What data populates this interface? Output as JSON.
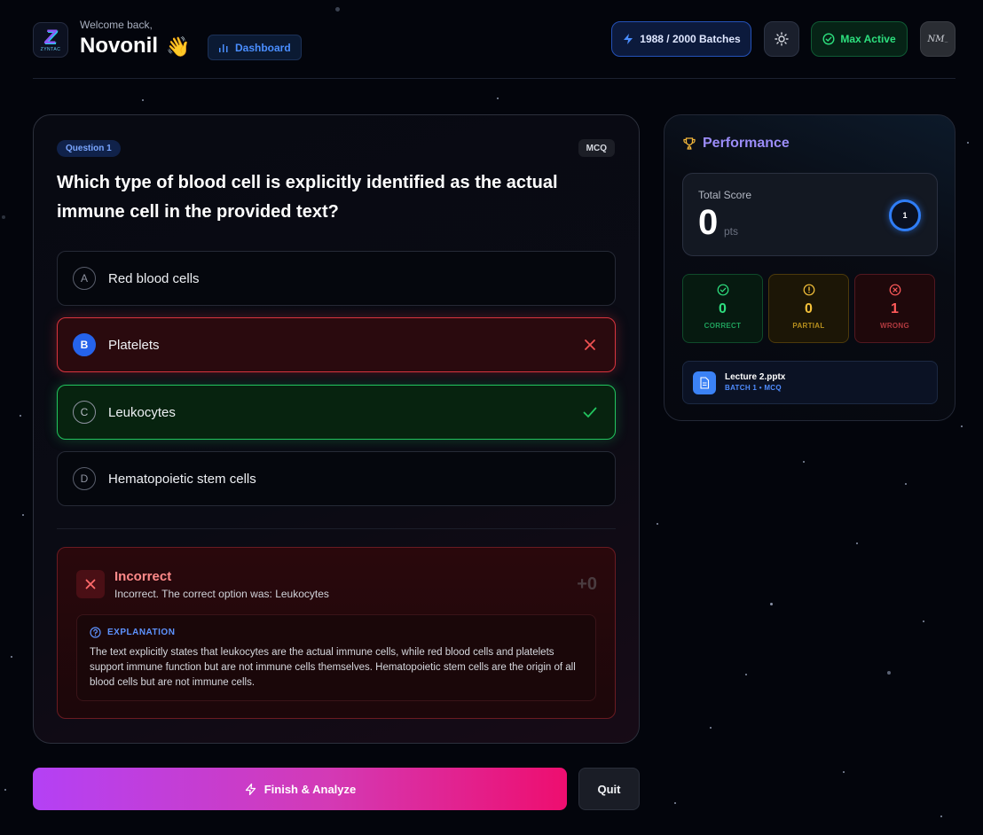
{
  "header": {
    "logo_text": "ZYNTAC",
    "welcome": "Welcome back,",
    "username": "Novonil",
    "wave": "👋",
    "dashboard_label": "Dashboard",
    "batches_label": "1988 / 2000 Batches",
    "max_active_label": "Max Active",
    "avatar_text": "NM"
  },
  "question": {
    "badge": "Question 1",
    "type": "MCQ",
    "text": "Which type of blood cell is explicitly identified as the actual immune cell in the provided text?",
    "options": [
      {
        "letter": "A",
        "text": "Red blood cells",
        "state": "neutral"
      },
      {
        "letter": "B",
        "text": "Platelets",
        "state": "wrong"
      },
      {
        "letter": "C",
        "text": "Leukocytes",
        "state": "correct"
      },
      {
        "letter": "D",
        "text": "Hematopoietic stem cells",
        "state": "neutral"
      }
    ]
  },
  "feedback": {
    "title": "Incorrect",
    "subtitle": "Incorrect. The correct option was: Leukocytes",
    "points": "+0",
    "explanation_label": "EXPLANATION",
    "explanation": "The text explicitly states that leukocytes are the actual immune cells, while red blood cells and platelets support immune function but are not immune cells themselves. Hematopoietic stem cells are the origin of all blood cells but are not immune cells."
  },
  "actions": {
    "finish_label": "Finish & Analyze",
    "quit_label": "Quit"
  },
  "performance": {
    "title": "Performance",
    "score_label": "Total Score",
    "score_value": "0",
    "score_unit": "pts",
    "ring_value": "1",
    "correct": {
      "value": "0",
      "label": "CORRECT"
    },
    "partial": {
      "value": "0",
      "label": "PARTIAL"
    },
    "wrong": {
      "value": "1",
      "label": "WRONG"
    },
    "file_name": "Lecture 2.pptx",
    "file_meta": "BATCH 1 • MCQ"
  },
  "colors": {
    "accent_blue": "#2563eb",
    "correct_green": "#22c55e",
    "wrong_red": "#d8343e",
    "partial_yellow": "#f6c23a",
    "finish_gradient_start": "#b441f5",
    "finish_gradient_end": "#ee0e6f"
  },
  "icons": {
    "dashboard": "bar-chart-icon",
    "batches": "lightning-icon",
    "theme": "sun-icon",
    "max_active": "check-circle-icon",
    "close": "x-icon",
    "check": "check-icon",
    "help": "help-circle-icon",
    "trophy": "trophy-icon",
    "file": "file-icon"
  }
}
